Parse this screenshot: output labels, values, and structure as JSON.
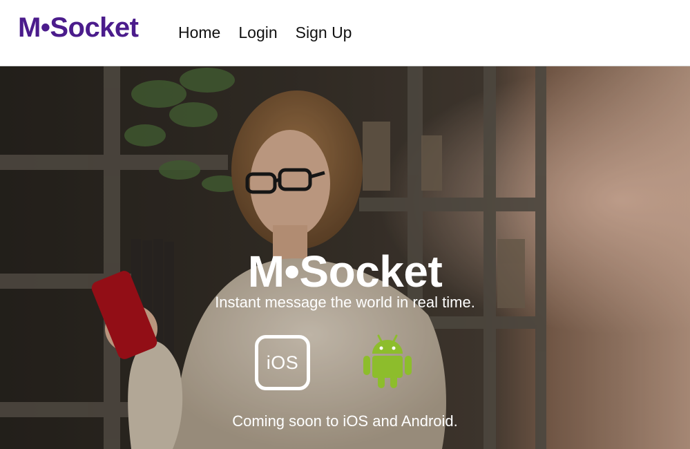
{
  "navbar": {
    "brand": "M•Socket",
    "links": [
      {
        "label": "Home"
      },
      {
        "label": "Login"
      },
      {
        "label": "Sign Up"
      }
    ]
  },
  "hero": {
    "title": "M•Socket",
    "tagline": "Instant message the world in real time.",
    "ios_label": "iOS",
    "coming_soon": "Coming soon to iOS and Android.",
    "icons": {
      "ios": "ios-icon",
      "android": "android-icon"
    }
  },
  "colors": {
    "brand": "#4b1c8c",
    "android_green": "#8dbd2c",
    "hero_text": "#ffffff"
  }
}
